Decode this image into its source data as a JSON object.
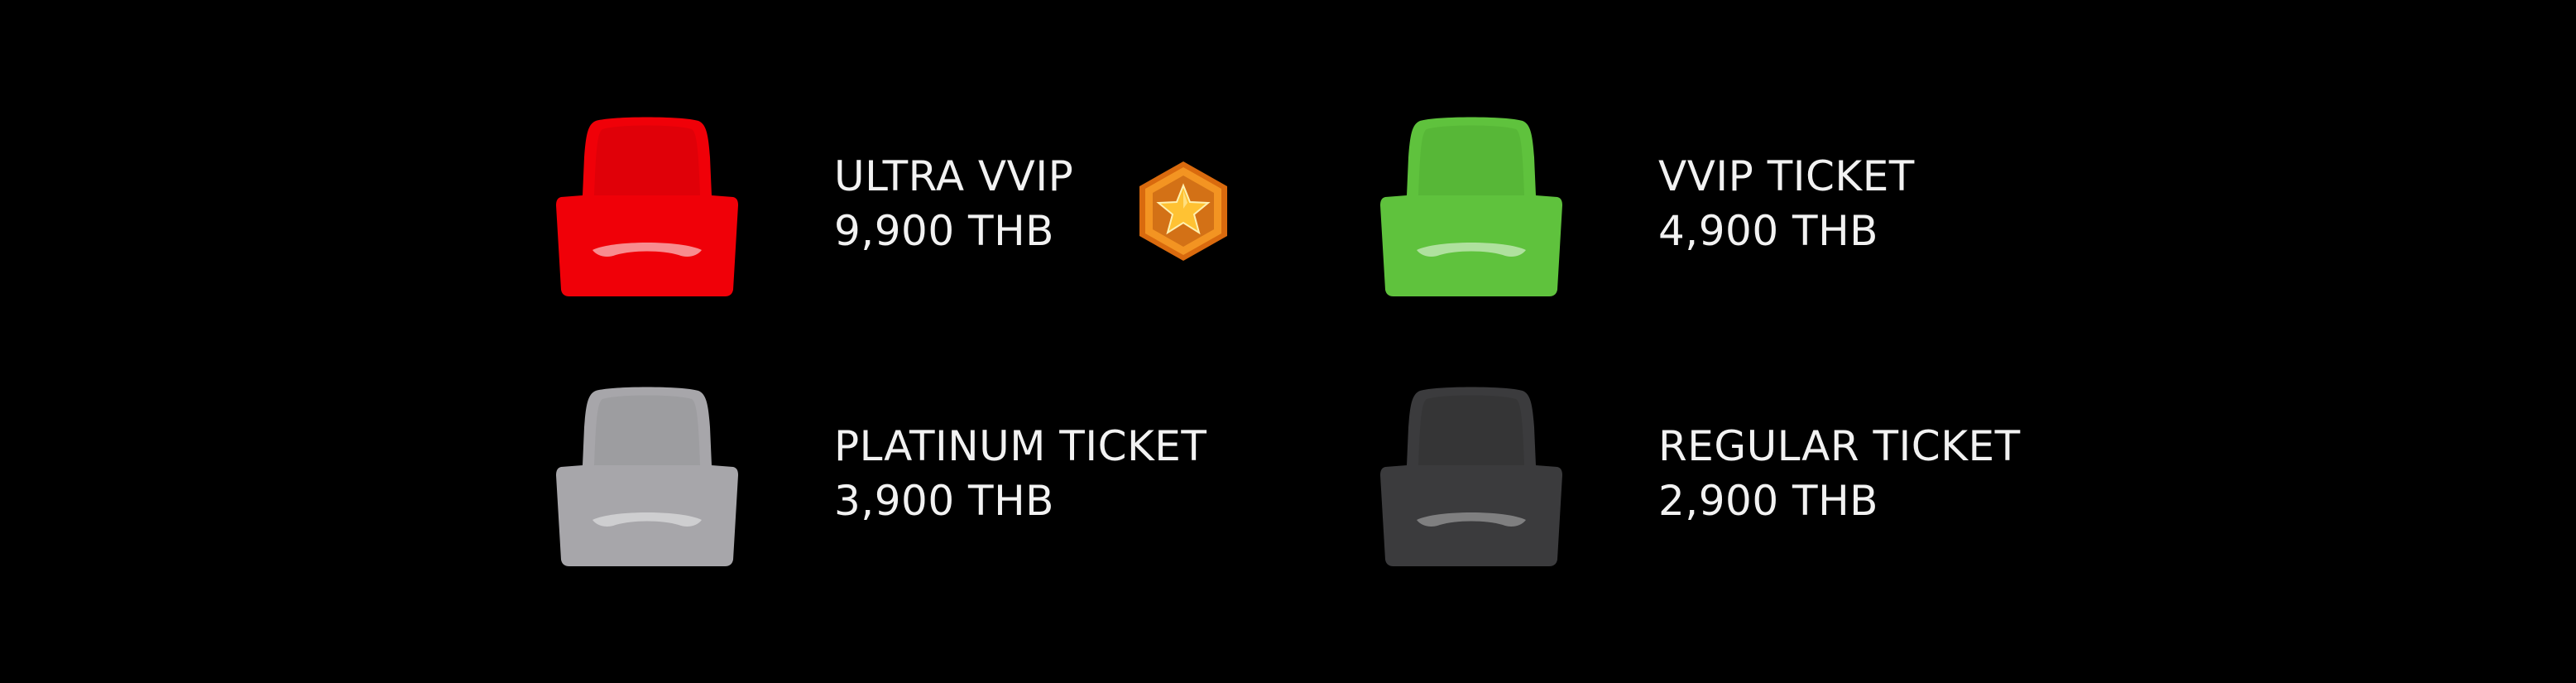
{
  "colors": {
    "background": "#000000",
    "text": "#f2f2f2",
    "badge_orange": "#f08a1c",
    "badge_star": "#ffc233"
  },
  "tiers": [
    {
      "name": "ULTRA VVIP",
      "price": "9,900 THB",
      "seat_color": "#f00008",
      "seat_shade": "#c4000a",
      "icon": "star-badge-icon"
    },
    {
      "name": "VVIP TICKET",
      "price": "4,900 THB",
      "seat_color": "#5fc23d",
      "seat_shade": "#4aa32d"
    },
    {
      "name": "PLATINUM TICKET",
      "price": "3,900 THB",
      "seat_color": "#a7a6aa",
      "seat_shade": "#8c8b90"
    },
    {
      "name": "REGULAR TICKET",
      "price": "2,900 THB",
      "seat_color": "#3b3b3d",
      "seat_shade": "#2b2b2c"
    }
  ]
}
